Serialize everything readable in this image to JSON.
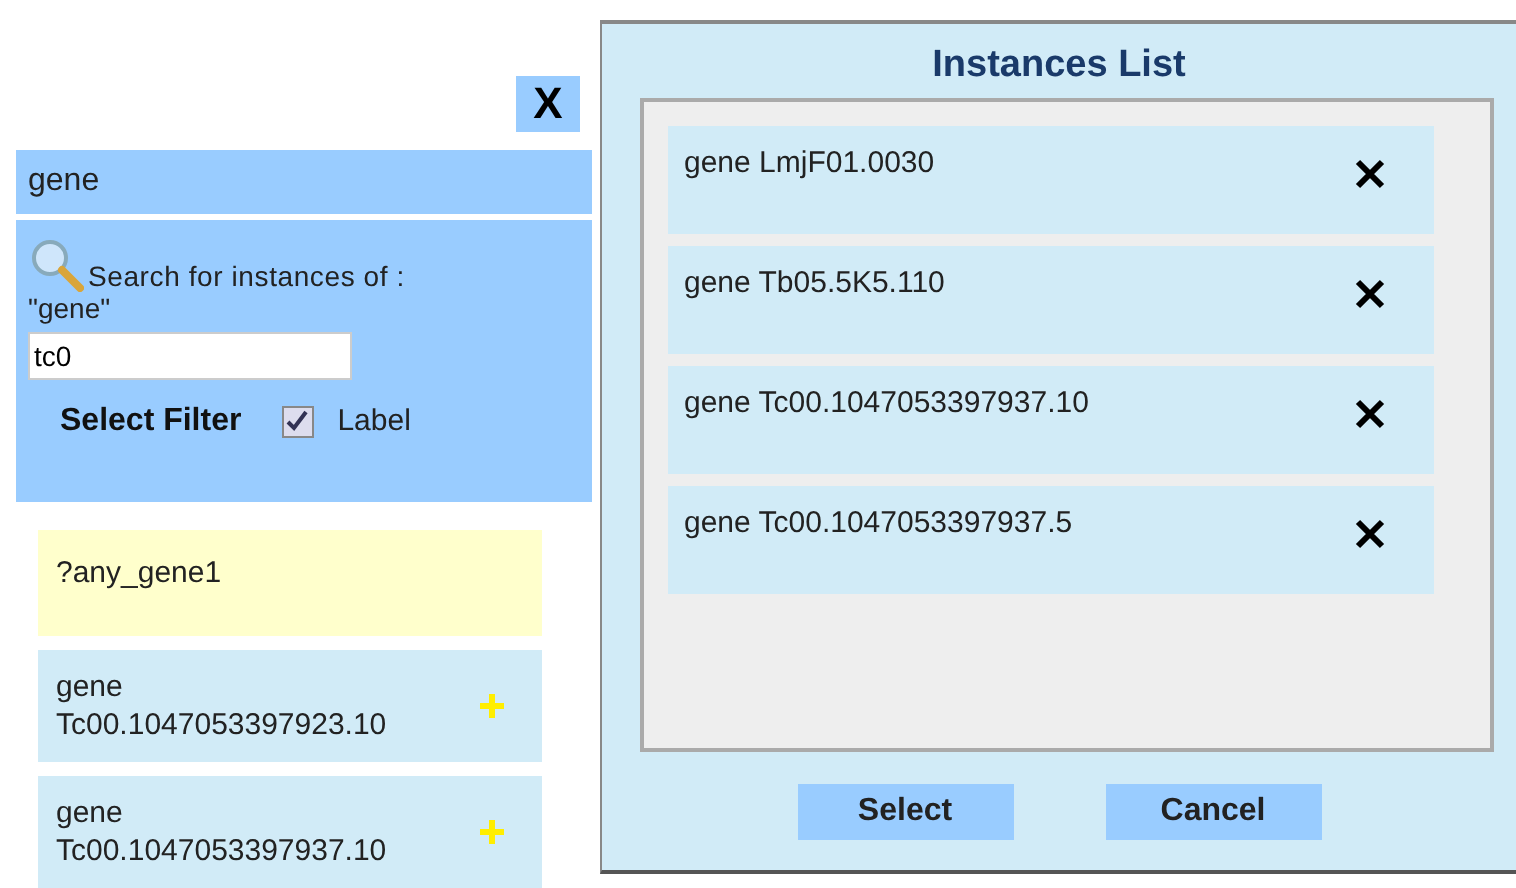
{
  "close_button": {
    "label": "X"
  },
  "concept": {
    "label": "gene"
  },
  "search": {
    "prompt": "Search for instances of :",
    "term": "\"gene\"",
    "value": "tc0"
  },
  "filter": {
    "label": "Select Filter",
    "option": "Label",
    "checked": true
  },
  "results": [
    {
      "kind": "variable",
      "lines": [
        "?any_gene1"
      ]
    },
    {
      "kind": "instance",
      "lines": [
        "gene",
        "Tc00.1047053397923.10"
      ]
    },
    {
      "kind": "instance",
      "lines": [
        "gene",
        "Tc00.1047053397937.10"
      ]
    }
  ],
  "dialog": {
    "title": "Instances List",
    "items": [
      "gene LmjF01.0030",
      "gene Tb05.5K5.110",
      "gene Tc00.1047053397937.10",
      "gene Tc00.1047053397937.5"
    ],
    "buttons": [
      "Select",
      "Cancel"
    ]
  }
}
